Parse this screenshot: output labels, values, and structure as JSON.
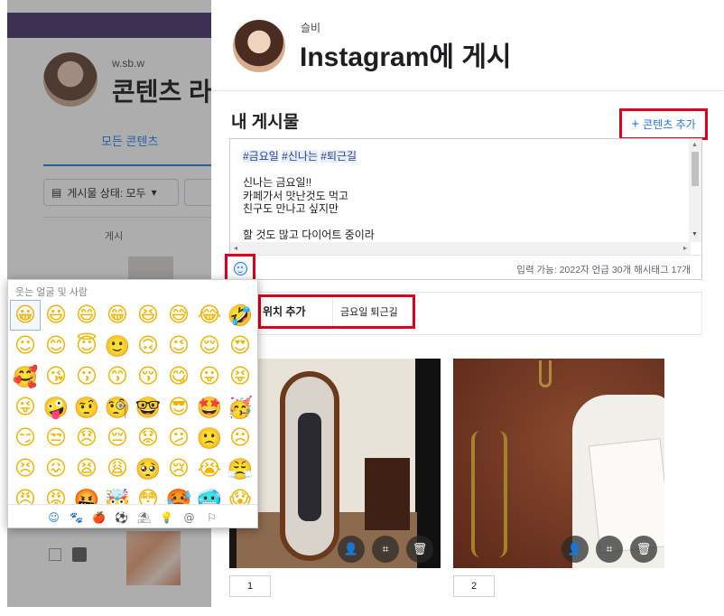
{
  "background": {
    "handle": "w.sb.w",
    "title": "콘텐츠 라",
    "tab": "모든 콘텐츠",
    "filter_label": "게시물 상태: 모두",
    "column_post": "게시"
  },
  "dialog": {
    "user_name": "슬비",
    "title": "Instagram에 게시",
    "section_title": "내 게시물",
    "add_content_label": "콘텐츠 추가",
    "caption": {
      "hashtags": [
        "#금요일",
        "#신나는",
        "#퇴근길"
      ],
      "lines": [
        "신나는 금요일!!",
        "카페가서 맛난것도 먹고",
        "친구도 만나고 싶지만",
        "",
        "할 것도 많고 다이어트 중이라"
      ]
    },
    "counter": "입력 가능: 2022자 언급 30개 해시태그 17개",
    "location_label": "위치 추가",
    "location_value": "금요일 퇴근길",
    "media": [
      {
        "index": "1"
      },
      {
        "index": "2"
      }
    ]
  },
  "emoji_picker": {
    "category_label": "웃는 얼굴 및 사람",
    "emojis": [
      "😀",
      "😃",
      "😄",
      "😁",
      "😆",
      "😅",
      "😂",
      "🤣",
      "☺",
      "😊",
      "😇",
      "🙂",
      "🙃",
      "😉",
      "😌",
      "😍",
      "🥰",
      "😘",
      "😗",
      "😙",
      "😚",
      "😋",
      "😛",
      "😝",
      "😜",
      "🤪",
      "🤨",
      "🧐",
      "🤓",
      "😎",
      "🤩",
      "🥳",
      "😏",
      "😒",
      "😞",
      "😔",
      "😟",
      "😕",
      "🙁",
      "☹",
      "😣",
      "😖",
      "😫",
      "😩",
      "🥺",
      "😢",
      "😭",
      "😤",
      "😠",
      "😡",
      "🤬",
      "🤯",
      "😳",
      "🥵",
      "🥶",
      "😱"
    ],
    "tabs": [
      "☺",
      "🐾",
      "🍎",
      "⚽",
      "⛱",
      "💡",
      "@",
      "⚐"
    ]
  },
  "colors": {
    "accent": "#1877f2",
    "highlight_border": "#e0001b",
    "hashtag_bg": "#e7f0fd"
  }
}
